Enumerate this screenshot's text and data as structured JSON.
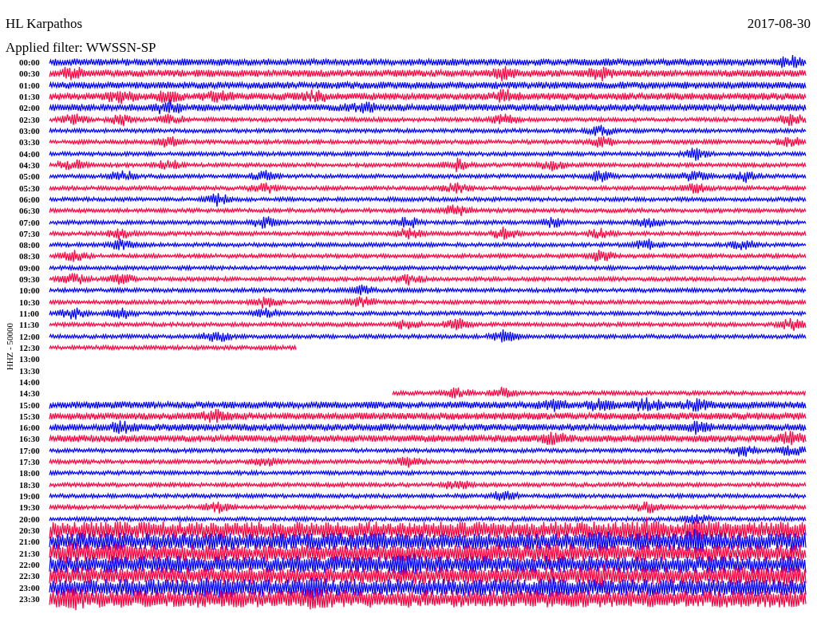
{
  "header": {
    "title": "HL Karpathos",
    "date": "2017-08-30",
    "filter": "Applied filter: WWSSN-SP"
  },
  "axis_label": "HHZ - 50000",
  "rows": [
    {
      "time": "00:00",
      "color": "#0000ff",
      "kind": "full"
    },
    {
      "time": "00:30",
      "color": "#ff0040",
      "kind": "full"
    },
    {
      "time": "01:00",
      "color": "#0000ff",
      "kind": "full"
    },
    {
      "time": "01:30",
      "color": "#ff0040",
      "kind": "full"
    },
    {
      "time": "02:00",
      "color": "#0000ff",
      "kind": "full"
    },
    {
      "time": "02:30",
      "color": "#ff0040",
      "kind": "full"
    },
    {
      "time": "03:00",
      "color": "#0000ff",
      "kind": "full"
    },
    {
      "time": "03:30",
      "color": "#ff0040",
      "kind": "full"
    },
    {
      "time": "04:00",
      "color": "#0000ff",
      "kind": "full"
    },
    {
      "time": "04:30",
      "color": "#ff0040",
      "kind": "full"
    },
    {
      "time": "05:00",
      "color": "#0000ff",
      "kind": "full"
    },
    {
      "time": "05:30",
      "color": "#ff0040",
      "kind": "full"
    },
    {
      "time": "06:00",
      "color": "#0000ff",
      "kind": "full"
    },
    {
      "time": "06:30",
      "color": "#ff0040",
      "kind": "full"
    },
    {
      "time": "07:00",
      "color": "#0000ff",
      "kind": "full"
    },
    {
      "time": "07:30",
      "color": "#ff0040",
      "kind": "full"
    },
    {
      "time": "08:00",
      "color": "#0000ff",
      "kind": "full"
    },
    {
      "time": "08:30",
      "color": "#ff0040",
      "kind": "full"
    },
    {
      "time": "09:00",
      "color": "#0000ff",
      "kind": "full"
    },
    {
      "time": "09:30",
      "color": "#ff0040",
      "kind": "full"
    },
    {
      "time": "10:00",
      "color": "#0000ff",
      "kind": "full"
    },
    {
      "time": "10:30",
      "color": "#ff0040",
      "kind": "full"
    },
    {
      "time": "11:00",
      "color": "#0000ff",
      "kind": "full"
    },
    {
      "time": "11:30",
      "color": "#ff0040",
      "kind": "full"
    },
    {
      "time": "12:00",
      "color": "#0000ff",
      "kind": "full"
    },
    {
      "time": "12:30",
      "color": "#ff0040",
      "kind": "head"
    },
    {
      "time": "13:00",
      "kind": "none"
    },
    {
      "time": "13:30",
      "kind": "none"
    },
    {
      "time": "14:00",
      "kind": "none"
    },
    {
      "time": "14:30",
      "color": "#ff0040",
      "kind": "tail"
    },
    {
      "time": "15:00",
      "color": "#0000ff",
      "kind": "full"
    },
    {
      "time": "15:30",
      "color": "#ff0040",
      "kind": "full"
    },
    {
      "time": "16:00",
      "color": "#0000ff",
      "kind": "full"
    },
    {
      "time": "16:30",
      "color": "#ff0040",
      "kind": "full"
    },
    {
      "time": "17:00",
      "color": "#0000ff",
      "kind": "full"
    },
    {
      "time": "17:30",
      "color": "#ff0040",
      "kind": "full"
    },
    {
      "time": "18:00",
      "color": "#0000ff",
      "kind": "full"
    },
    {
      "time": "18:30",
      "color": "#ff0040",
      "kind": "full"
    },
    {
      "time": "19:00",
      "color": "#0000ff",
      "kind": "full"
    },
    {
      "time": "19:30",
      "color": "#ff0040",
      "kind": "full"
    },
    {
      "time": "20:00",
      "color": "#0000ff",
      "kind": "full"
    },
    {
      "time": "20:30",
      "color": "#ff0040",
      "kind": "full"
    },
    {
      "time": "21:00",
      "color": "#0000ff",
      "kind": "full"
    },
    {
      "time": "21:30",
      "color": "#ff0040",
      "kind": "full"
    },
    {
      "time": "22:00",
      "color": "#0000ff",
      "kind": "full"
    },
    {
      "time": "22:30",
      "color": "#ff0040",
      "kind": "full"
    },
    {
      "time": "23:00",
      "color": "#0000ff",
      "kind": "full"
    },
    {
      "time": "23:30",
      "color": "#ff0040",
      "kind": "full"
    }
  ]
}
